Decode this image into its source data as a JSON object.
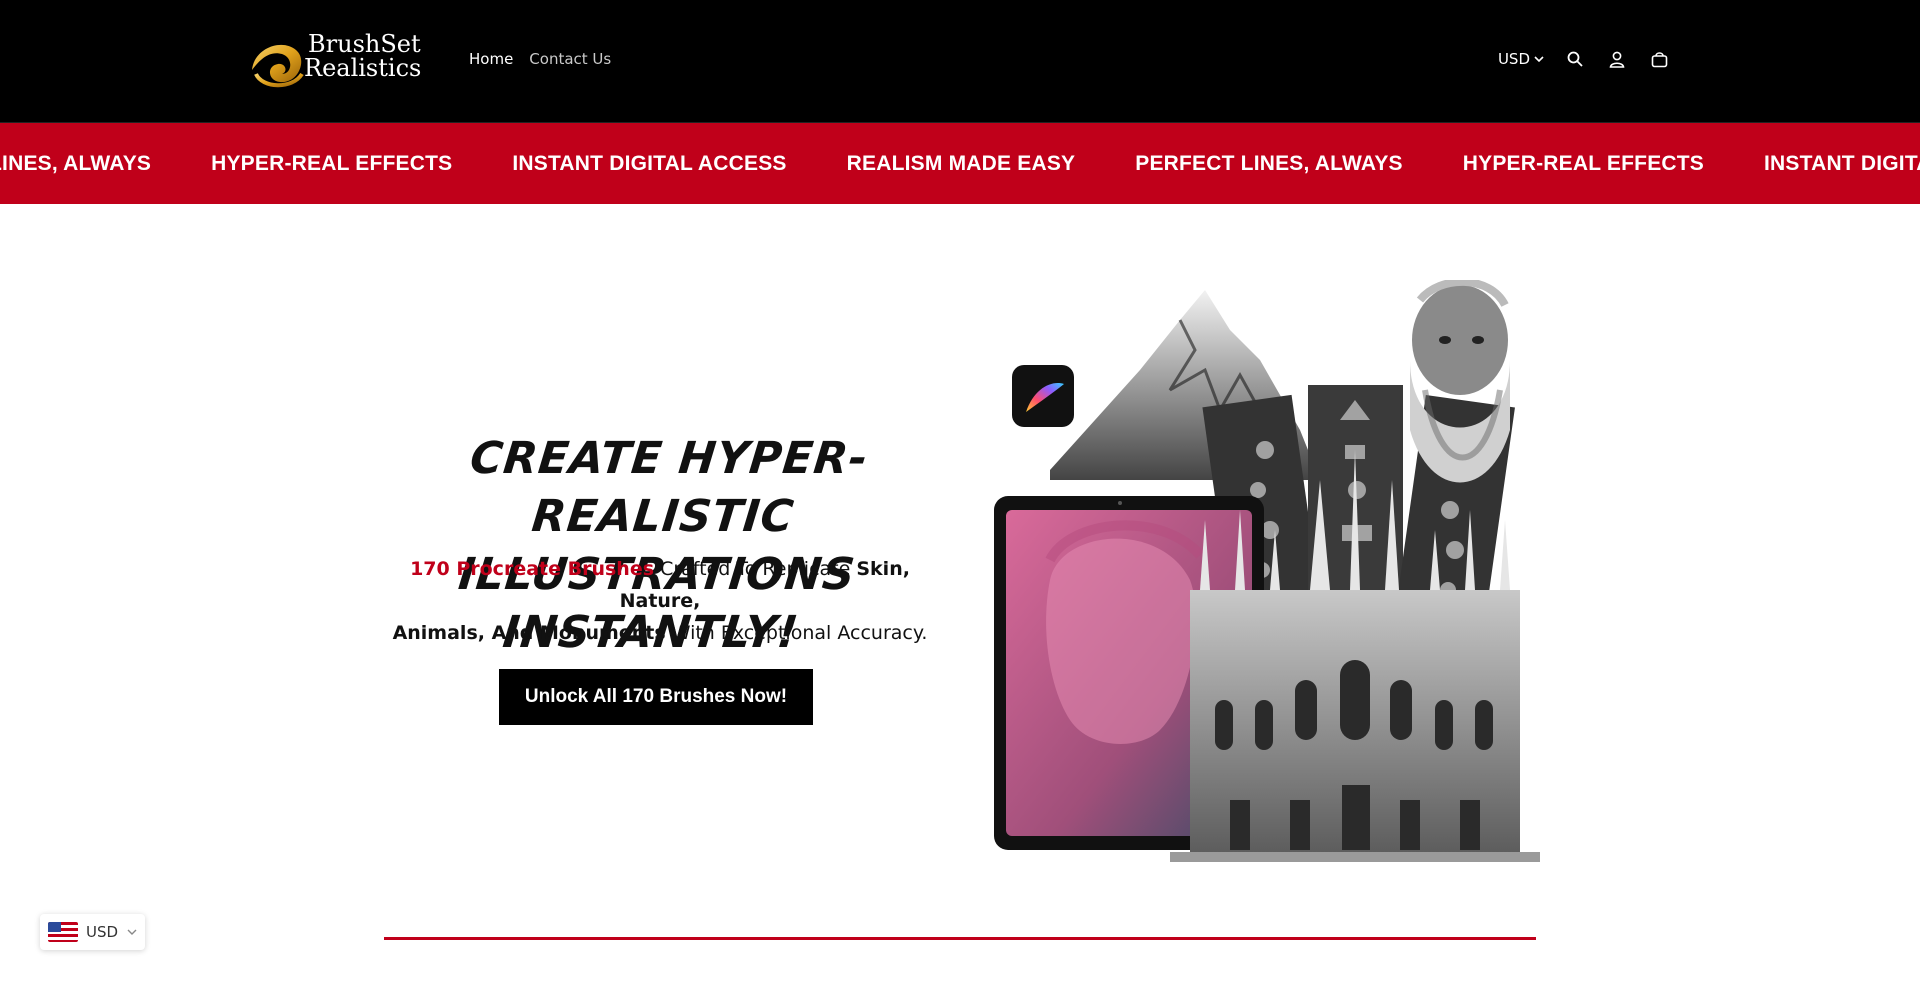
{
  "brand": {
    "name_line1": "BrushSet",
    "name_line2": "Realistics"
  },
  "nav": {
    "items": [
      {
        "label": "Home"
      },
      {
        "label": "Contact Us"
      }
    ]
  },
  "header": {
    "currency": "USD",
    "icons": [
      "search-icon",
      "account-icon",
      "cart-icon",
      "chevron-down-icon"
    ]
  },
  "ticker": {
    "items": [
      "RFECT LINES, ALWAYS",
      "HYPER-REAL EFFECTS",
      "INSTANT DIGITAL ACCESS",
      "REALISM MADE EASY",
      "PERFECT LINES, ALWAYS",
      "HYPER-REAL EFFECTS",
      "INSTANT DIGITAL ACCESS"
    ]
  },
  "hero": {
    "title_line1": "Create Hyper-Realistic",
    "title_line2": "Illustrations Instantly!",
    "sub_highlight": "170 Procreate Brushes",
    "sub_text1": " Crafted To Replicate ",
    "sub_bold1": "Skin, Nature,",
    "sub_bold2": "Animals, And Monuments",
    "sub_text2": " With Exceptional Accuracy.",
    "cta_label": "Unlock All 170 Brushes Now!"
  },
  "currency_widget": {
    "label": "USD"
  },
  "colors": {
    "brand_red": "#c0001a",
    "header_bg": "#000000",
    "accent_gold": "#e0a11b"
  }
}
